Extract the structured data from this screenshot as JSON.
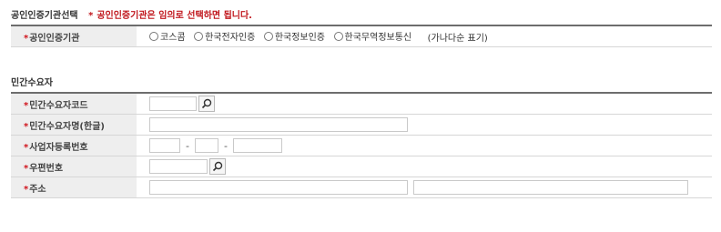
{
  "cert_section": {
    "title": "공인인증기관선택",
    "note_star": "*",
    "note": "공인인증기관은 임의로 선택하면 됩니다.",
    "row_label": "공인인증기관",
    "options": [
      "코스콤",
      "한국전자인증",
      "한국정보인증",
      "한국무역정보통신"
    ],
    "remark": "(가나다순 표기)"
  },
  "customer_section": {
    "title": "민간수요자",
    "fields": {
      "code": {
        "label": "민간수요자코드",
        "value": ""
      },
      "name": {
        "label": "민간수요자명(한글)",
        "value": ""
      },
      "biz_no": {
        "label": "사업자등록번호",
        "dash": "-"
      },
      "postal": {
        "label": "우편번호",
        "value": ""
      },
      "address": {
        "label": "주소",
        "value": ""
      }
    }
  },
  "required_mark": "*",
  "icons": {
    "search": "search-icon"
  }
}
